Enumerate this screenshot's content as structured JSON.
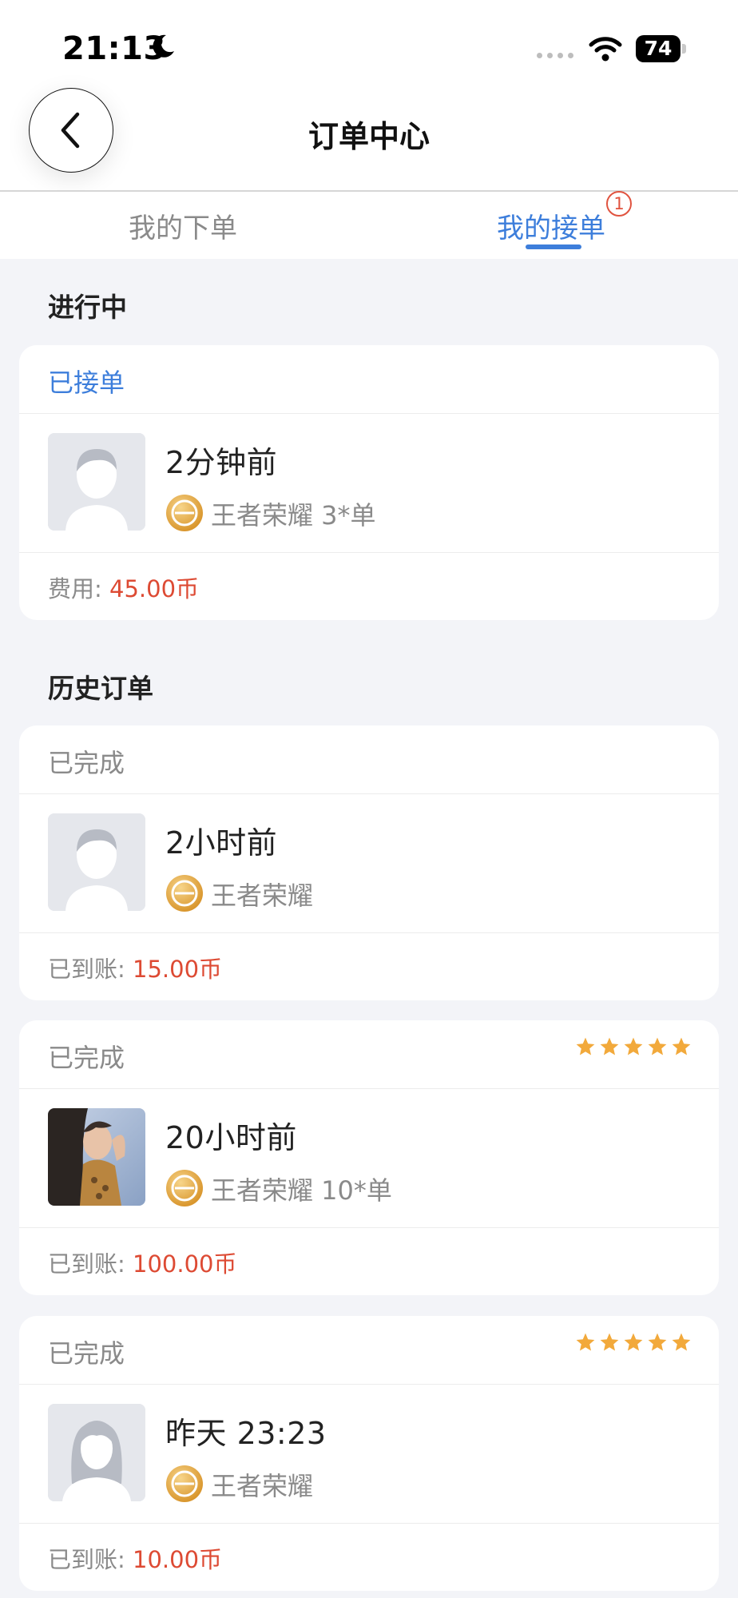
{
  "status_bar": {
    "time": "21:13",
    "battery": "74"
  },
  "header": {
    "title": "订单中心"
  },
  "tabs": [
    {
      "label": "我的下单",
      "active": false
    },
    {
      "label": "我的接单",
      "active": true,
      "badge": "1"
    }
  ],
  "sections": {
    "in_progress": "进行中",
    "history": "历史订单"
  },
  "orders": [
    {
      "status": "已接单",
      "time": "2分钟前",
      "game": "王者荣耀 3*单",
      "fee_label": "费用:",
      "fee_value": "45.00币",
      "rating": 0,
      "avatar": "male-placeholder"
    },
    {
      "status": "已完成",
      "time": "2小时前",
      "game": "王者荣耀",
      "fee_label": "已到账:",
      "fee_value": "15.00币",
      "rating": 0,
      "avatar": "male-placeholder"
    },
    {
      "status": "已完成",
      "time": "20小时前",
      "game": "王者荣耀 10*单",
      "fee_label": "已到账:",
      "fee_value": "100.00币",
      "rating": 5,
      "avatar": "photo"
    },
    {
      "status": "已完成",
      "time": "昨天 23:23",
      "game": "王者荣耀",
      "fee_label": "已到账:",
      "fee_value": "10.00币",
      "rating": 5,
      "avatar": "female-placeholder"
    }
  ],
  "colors": {
    "accent": "#3d7edb",
    "price": "#dd4a33",
    "star": "#f2a93b",
    "background": "#f3f4f8"
  }
}
